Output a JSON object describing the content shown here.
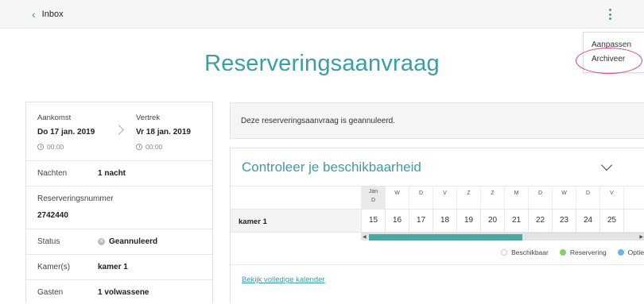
{
  "topbar": {
    "back_label": "Inbox"
  },
  "menu": {
    "items": [
      "Aanpassen",
      "Archiveer"
    ]
  },
  "page": {
    "title": "Reserveringsaanvraag"
  },
  "summary": {
    "arrival": {
      "label": "Aankomst",
      "date": "Do 17 jan. 2019",
      "time": "00:00"
    },
    "departure": {
      "label": "Vertrek",
      "date": "Vr 18 jan. 2019",
      "time": "00:00"
    },
    "nights": {
      "label": "Nachten",
      "value": "1 nacht"
    },
    "reservation_number": {
      "label": "Reserveringsnummer",
      "value": "2742440"
    },
    "status": {
      "label": "Status",
      "value": "Geannuleerd"
    },
    "rooms": {
      "label": "Kamer(s)",
      "value": "kamer 1"
    },
    "guests": {
      "label": "Gasten",
      "value": "1 volwassene"
    }
  },
  "notice": {
    "text": "Deze reserveringsaanvraag is geannuleerd."
  },
  "availability": {
    "title": "Controleer je beschikbaarheid",
    "room": "kamer 1",
    "days": [
      {
        "month": "Jan",
        "weekday": "D",
        "date": "15"
      },
      {
        "month": "",
        "weekday": "W",
        "date": "16"
      },
      {
        "month": "",
        "weekday": "D",
        "date": "17"
      },
      {
        "month": "",
        "weekday": "V",
        "date": "18"
      },
      {
        "month": "",
        "weekday": "Z",
        "date": "19"
      },
      {
        "month": "",
        "weekday": "Z",
        "date": "20"
      },
      {
        "month": "",
        "weekday": "M",
        "date": "21"
      },
      {
        "month": "",
        "weekday": "D",
        "date": "22"
      },
      {
        "month": "",
        "weekday": "W",
        "date": "23"
      },
      {
        "month": "",
        "weekday": "D",
        "date": "24"
      },
      {
        "month": "",
        "weekday": "V",
        "date": "25"
      },
      {
        "month": "",
        "weekday": "",
        "date": ""
      }
    ],
    "legend": [
      {
        "label": "Beschikbaar",
        "color": "#ffffff"
      },
      {
        "label": "Reservering",
        "color": "#7ed36b"
      },
      {
        "label": "Optie",
        "color": "#6fb3e0"
      }
    ],
    "full_calendar_link": "Bekijk volledige kalender"
  },
  "colors": {
    "accent": "#3a9ea5",
    "highlight": "#d6407d"
  }
}
